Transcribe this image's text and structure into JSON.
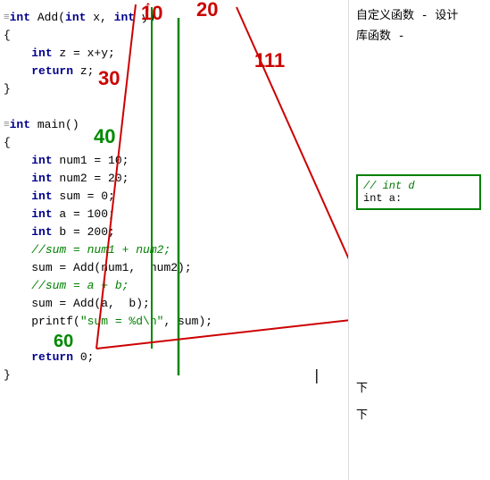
{
  "code": {
    "lines": [
      {
        "indent": 0,
        "content": "≡int Add(int x, int y)",
        "classes": [
          "kw-line"
        ]
      },
      {
        "indent": 0,
        "content": "{"
      },
      {
        "indent": 2,
        "content": "int z = x+y;"
      },
      {
        "indent": 2,
        "content": "return z;"
      },
      {
        "indent": 0,
        "content": "}"
      },
      {
        "indent": 0,
        "content": ""
      },
      {
        "indent": 0,
        "content": "≡int main()"
      },
      {
        "indent": 0,
        "content": "{"
      },
      {
        "indent": 2,
        "content": "int num1 = 10;"
      },
      {
        "indent": 2,
        "content": "int num2 = 20;"
      },
      {
        "indent": 2,
        "content": "int sum = 0;"
      },
      {
        "indent": 2,
        "content": "int a = 100;"
      },
      {
        "indent": 2,
        "content": "int b = 200;"
      },
      {
        "indent": 2,
        "content": "//sum = num1 + num2;"
      },
      {
        "indent": 2,
        "content": "sum = Add(num1, num2);"
      },
      {
        "indent": 2,
        "content": "//sum = a + b;"
      },
      {
        "indent": 2,
        "content": "sum = Add(a, b);"
      },
      {
        "indent": 2,
        "content": "printf(\"sum = %d\\n\", sum);"
      },
      {
        "indent": 0,
        "content": ""
      },
      {
        "indent": 2,
        "content": "return 0;"
      },
      {
        "indent": 0,
        "content": "}"
      }
    ]
  },
  "right": {
    "label1": "自定义函数 - 设计",
    "label2": "库函数 -",
    "box_line1": "// int d",
    "box_line2": "int a:",
    "bottom1": "下",
    "bottom2": "下"
  },
  "annotations": {
    "num10": "10",
    "num20": "20",
    "num30": "30",
    "num40": "40",
    "num60": "60",
    "flag_arrow": "↑"
  }
}
